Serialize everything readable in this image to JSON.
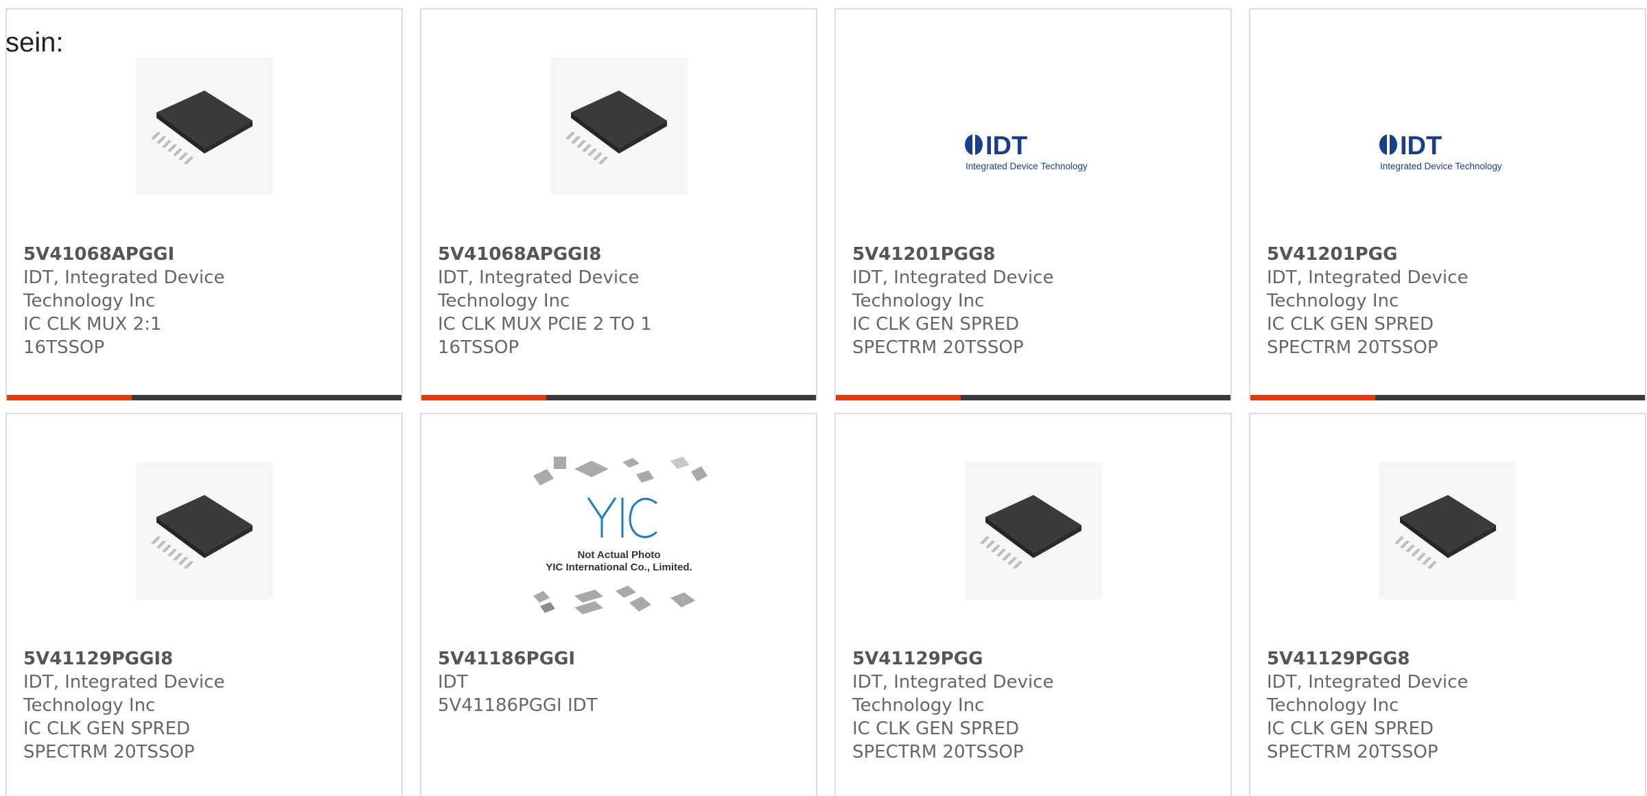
{
  "intro_text": "sein:",
  "colors": {
    "accent": "#e23a0e",
    "bar_dark": "#3b3b3b",
    "border": "#dcdcdc",
    "logo_blue": "#1a3e8c"
  },
  "products": [
    {
      "part_number": "5V41068APGGI",
      "manufacturer": "IDT, Integrated Device Technology Inc",
      "description": "IC CLK MUX 2:1 16TSSOP",
      "image": "tssop-chip-icon"
    },
    {
      "part_number": "5V41068APGGI8",
      "manufacturer": "IDT, Integrated Device Technology Inc",
      "description": "IC CLK MUX PCIE 2 TO 1 16TSSOP",
      "image": "tssop-chip-icon"
    },
    {
      "part_number": "5V41201PGG8",
      "manufacturer": "IDT, Integrated Device Technology Inc",
      "description": "IC CLK GEN SPRED SPECTRM 20TSSOP",
      "image": "idt-logo",
      "logo_text": "IDT",
      "logo_subtext": "Integrated Device Technology"
    },
    {
      "part_number": "5V41201PGG",
      "manufacturer": "IDT, Integrated Device Technology Inc",
      "description": "IC CLK GEN SPRED SPECTRM 20TSSOP",
      "image": "idt-logo",
      "logo_text": "IDT",
      "logo_subtext": "Integrated Device Technology"
    },
    {
      "part_number": "5V41129PGGI8",
      "manufacturer": "IDT, Integrated Device Technology Inc",
      "description": "IC CLK GEN SPRED SPECTRM 20TSSOP",
      "image": "tssop-chip-icon"
    },
    {
      "part_number": "5V41186PGGI",
      "manufacturer": "IDT",
      "description": "5V41186PGGI IDT",
      "image": "yic-placeholder",
      "logo_text": "YIC",
      "placeholder_line1": "Not Actual Photo",
      "placeholder_line2": "YIC International Co., Limited."
    },
    {
      "part_number": "5V41129PGG",
      "manufacturer": "IDT, Integrated Device Technology Inc",
      "description": "IC CLK GEN SPRED SPECTRM 20TSSOP",
      "image": "tssop-chip-icon"
    },
    {
      "part_number": "5V41129PGG8",
      "manufacturer": "IDT, Integrated Device Technology Inc",
      "description": "IC CLK GEN SPRED SPECTRM 20TSSOP",
      "image": "tssop-chip-icon"
    }
  ]
}
